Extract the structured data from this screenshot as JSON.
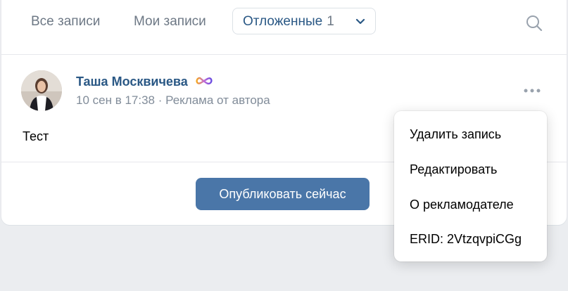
{
  "tabs": {
    "all_label": "Все записи",
    "mine_label": "Мои записи",
    "postponed_label": "Отложенные",
    "postponed_count": "1"
  },
  "post": {
    "author": "Таша Москвичева",
    "date": "10 сен в 17:38",
    "ad_label": "Реклама от автора",
    "text": "Тест",
    "publish_label": "Опубликовать сейчас"
  },
  "menu": {
    "items": [
      "Удалить запись",
      "Редактировать",
      "О рекламодателе",
      "ERID: 2VtzqvpiCGg"
    ]
  },
  "colors": {
    "accent": "#4a76a8",
    "link": "#2a5885",
    "muted": "#818c99",
    "background": "#ebedf0"
  },
  "icons": [
    "search-icon",
    "chevron-down-icon",
    "infinity-icon",
    "more-icon"
  ]
}
